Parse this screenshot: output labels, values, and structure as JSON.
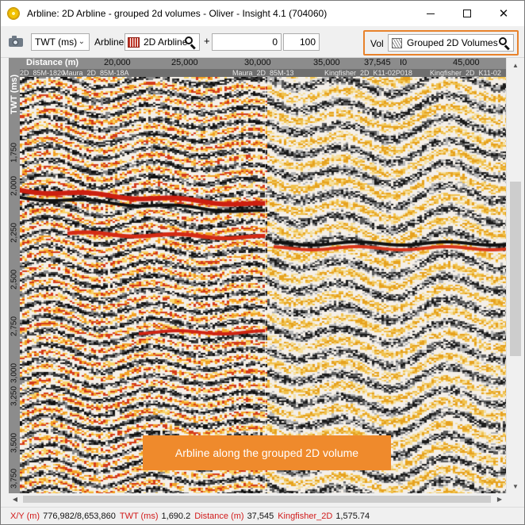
{
  "window": {
    "title": "Arbline: 2D Arbline - grouped 2d volumes - Oliver - Insight 4.1 (704060)"
  },
  "toolbar": {
    "domain_value": "TWT (ms)",
    "arbline_label": "Arbline",
    "arbline_value": "2D Arbline",
    "plus": "+",
    "offset_value": "0",
    "percent_value": "100",
    "vol_label": "Vol",
    "vol_value": "Grouped 2D Volumes"
  },
  "axes": {
    "x_title": "Distance (m)",
    "x_ticks": [
      "20,000",
      "25,000",
      "30,000",
      "35,000",
      "37,545",
      "I0",
      "45,000"
    ],
    "y_title": "TWT (ms)",
    "y_ticks": [
      "1,750",
      "2,000",
      "2,250",
      "2,500",
      "2,750",
      "3,000",
      "3,250",
      "3,500",
      "3,750"
    ]
  },
  "line_labels": [
    "2D_85M-1820",
    "Maura_2D_85M-18A",
    "Maura_2D_85M-13",
    "Kingfisher_2D_K11-02P018",
    "Kingfisher_2D_K11-02"
  ],
  "callout": "Arbline along the grouped 2D volume",
  "status": [
    {
      "key": "X/Y (m)",
      "value": "776,982/8,653,860"
    },
    {
      "key": "TWT (ms)",
      "value": "1,690.2"
    },
    {
      "key": "Distance (m)",
      "value": "37,545"
    },
    {
      "key": "Kingfisher_2D",
      "value": "1,575.74"
    }
  ],
  "colors": {
    "highlight": "#e8822b",
    "callout": "#ef8a2c",
    "status_key": "#d11a1a"
  },
  "icons": {
    "app": "app-logo-icon",
    "screenshot": "camera-icon",
    "arbline": "arbline-icon",
    "volume": "volume-icon",
    "search": "search-icon"
  }
}
